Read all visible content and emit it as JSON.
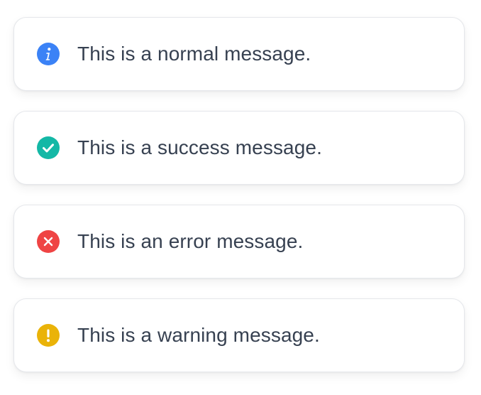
{
  "toasts": [
    {
      "kind": "info",
      "icon": "info-icon",
      "color": "#3b82f6",
      "text": "This is a normal message."
    },
    {
      "kind": "success",
      "icon": "check-circle-icon",
      "color": "#14b8a6",
      "text": "This is a success message."
    },
    {
      "kind": "error",
      "icon": "x-circle-icon",
      "color": "#ef4444",
      "text": "This is an error message."
    },
    {
      "kind": "warning",
      "icon": "exclamation-icon",
      "color": "#eab308",
      "text": "This is a warning message."
    }
  ]
}
